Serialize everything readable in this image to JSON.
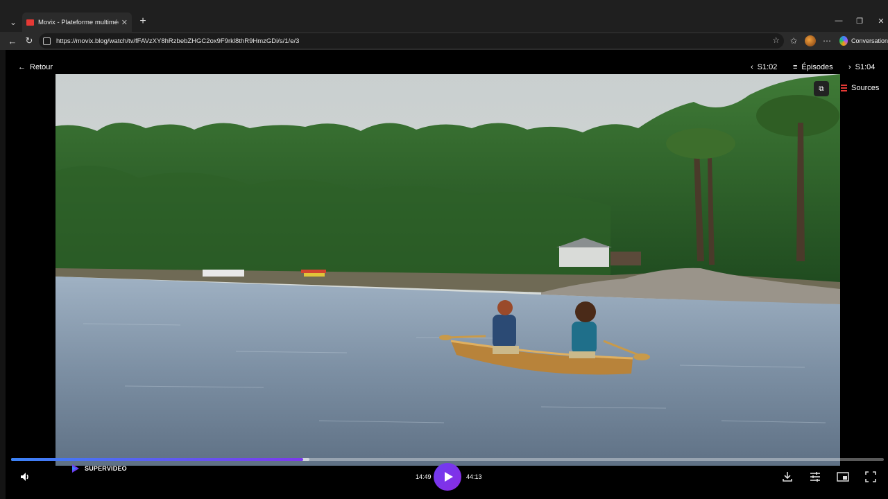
{
  "browser": {
    "tab_title": "Movix - Plateforme multimédia pr",
    "url": "https://movix.blog/watch/tv/fFAVzXY8hRzbebZHGC2ox9F9rkl8thR9HmzGDi/s/1/e/3",
    "copilot_label": "Conversation"
  },
  "player_nav": {
    "back_label": "Retour",
    "prev_episode": "S1:02",
    "episodes_label": "Épisodes",
    "next_episode": "S1:04",
    "sources_label": "Sources"
  },
  "controls": {
    "current_time": "14:49",
    "duration": "44:13",
    "played_fraction": 0.335,
    "buffered_fraction": 0.342,
    "brand": "SUPERVIDEO"
  },
  "colors": {
    "accent": "#7c3aed",
    "sources_icon": "#e53935"
  }
}
